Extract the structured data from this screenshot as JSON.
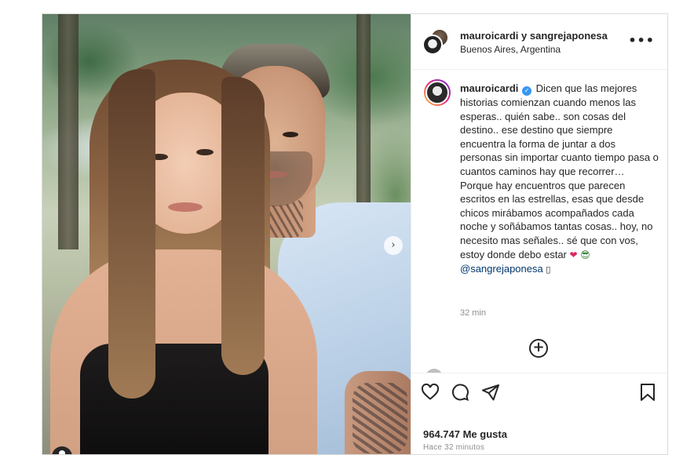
{
  "header": {
    "names": "mauroicardi y sangrejaponesa",
    "location": "Buenos Aires, Argentina",
    "more_label": "•••"
  },
  "caption": {
    "username": "mauroicardi",
    "verified_icon": "✓",
    "text": "Dicen que las mejores historias comienzan cuando menos las esperas.. quién sabe.. son cosas del destino.. ese destino que siempre encuentra la forma de juntar a dos personas sin importar cuanto tiempo pasa o cuantos caminos hay que recorrer… Porque hay encuentros que parecen escritos en las estrellas, esas que desde chicos mirábamos acompañados cada noche y soñábamos tantas cosas.. hoy, no necesito mas señales.. sé que con vos, estoy donde debo estar",
    "emoji_heart": "❤",
    "emoji_face": "😎",
    "mention": "@sangrejaponesa",
    "trailing_glyph": "▯",
    "time": "32 min"
  },
  "load_more_label": "+",
  "carousel_next_label": "›",
  "actions": {
    "icons": [
      "heart-icon",
      "comment-icon",
      "share-icon",
      "bookmark-icon"
    ],
    "likes": "964.747 Me gusta",
    "posted": "Hace 32 minutos"
  },
  "colors": {
    "text": "#262626",
    "muted": "#8e8e8e",
    "mention": "#00376b",
    "verified": "#3897f0",
    "border": "#dbdbdb"
  }
}
